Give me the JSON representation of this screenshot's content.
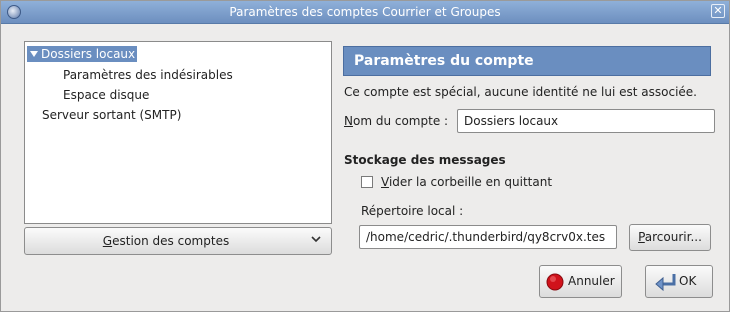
{
  "window": {
    "title": "Paramètres des comptes Courrier et Groupes",
    "close_glyph": "✕"
  },
  "tree": {
    "items": [
      {
        "label": "Dossiers locaux"
      },
      {
        "label": "Paramètres des indésirables"
      },
      {
        "label": "Espace disque"
      },
      {
        "label": "Serveur sortant (SMTP)"
      }
    ],
    "selected_index": 0
  },
  "manage_button": {
    "label": "Gestion des comptes",
    "icon": "chevron-down-icon"
  },
  "account": {
    "header": "Paramètres du compte",
    "description": "Ce compte est spécial, aucune identité ne lui est associée.",
    "name_label": "Nom du compte :",
    "name_value": "Dossiers locaux"
  },
  "storage": {
    "title": "Stockage des messages",
    "empty_trash_label": "Vider la corbeille en quittant",
    "empty_trash_checked": false,
    "local_dir_label": "Répertoire local :",
    "local_dir_value": "/home/cedric/.thunderbird/qy8crv0x.tes",
    "browse_label": "Parcourir..."
  },
  "buttons": {
    "cancel": "Annuler",
    "ok": "OK"
  },
  "colors": {
    "selection": "#6a8ec0",
    "titlebar": "#7c9dcc",
    "cancel_icon": "#d0121b"
  }
}
